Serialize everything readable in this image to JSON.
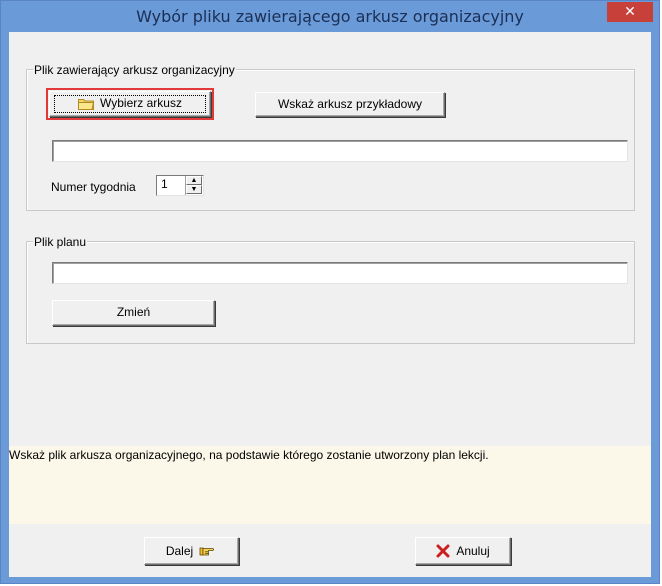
{
  "window": {
    "title": "Wybór pliku zawierającego arkusz organizacyjny",
    "close_glyph": "✕"
  },
  "group_sheet": {
    "legend": "Plik zawierający arkusz organizacyjny",
    "choose_button_label": "Wybierz arkusz",
    "choose_button_icon": "folder-icon",
    "example_button_label": "Wskaż arkusz przykładowy",
    "sheet_path_value": "",
    "week_label": "Numer tygodnia",
    "week_value": "1"
  },
  "group_plan": {
    "legend": "Plik planu",
    "plan_path_value": "",
    "change_button_label": "Zmień"
  },
  "hint": {
    "text": "Wskaż plik arkusza organizacyjnego,  na podstawie którego zostanie utworzony plan lekcji."
  },
  "footer": {
    "next_label": "Dalej",
    "next_icon": "pointing-hand-icon",
    "cancel_label": "Anuluj",
    "cancel_icon": "red-x-icon"
  },
  "colors": {
    "titlebar": "#6a9ad8",
    "close_button": "#c8403a",
    "focus_outline": "#e23a3a",
    "hint_background": "#fbf7e9"
  }
}
